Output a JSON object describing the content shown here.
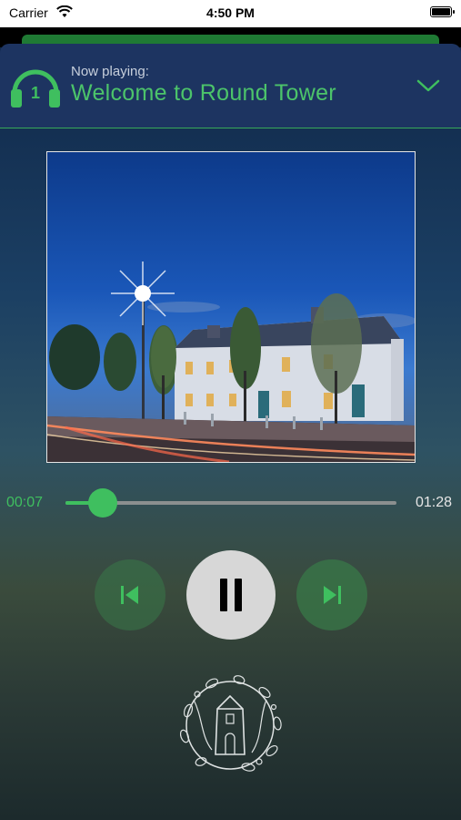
{
  "status_bar": {
    "carrier": "Carrier",
    "time": "4:50 PM"
  },
  "player": {
    "now_playing_label": "Now playing:",
    "track_title": "Welcome to Round Tower",
    "track_number": "1",
    "elapsed": "00:07",
    "duration": "01:28",
    "progress_fraction": 0.08,
    "state": "playing"
  },
  "colors": {
    "accent": "#3fbf5f",
    "header_bg": "#1d3461"
  },
  "icons": {
    "headphones": "headphones-icon",
    "chevron": "chevron-down-icon",
    "prev": "skip-previous-icon",
    "pause": "pause-icon",
    "next": "skip-next-icon",
    "logo": "round-tower-logo"
  }
}
